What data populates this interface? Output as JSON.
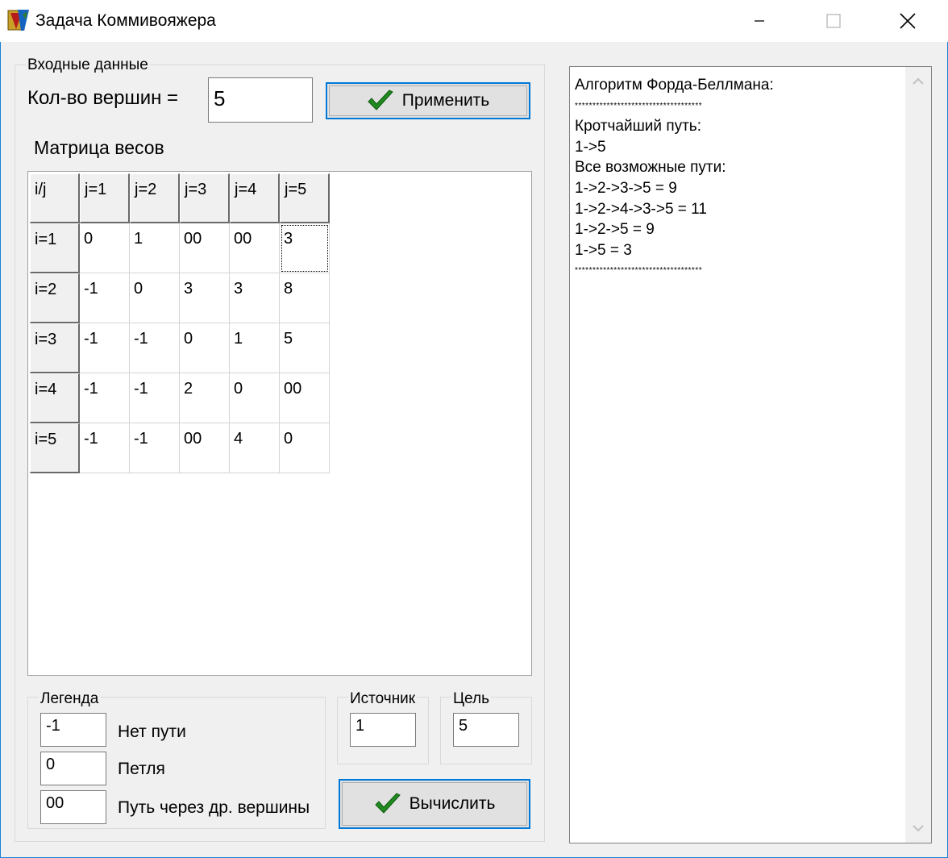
{
  "window": {
    "title": "Задача Коммивояжера"
  },
  "input_group": {
    "label": "Входные данные",
    "vertex_count_label": "Кол-во вершин =",
    "vertex_count_value": "5",
    "apply_button": "Применить",
    "matrix_label": "Матрица весов"
  },
  "matrix": {
    "corner": "i/j",
    "col_headers": [
      "j=1",
      "j=2",
      "j=3",
      "j=4",
      "j=5"
    ],
    "row_headers": [
      "i=1",
      "i=2",
      "i=3",
      "i=4",
      "i=5"
    ],
    "rows": [
      [
        "0",
        "1",
        "00",
        "00",
        "3"
      ],
      [
        "-1",
        "0",
        "3",
        "3",
        "8"
      ],
      [
        "-1",
        "-1",
        "0",
        "1",
        "5"
      ],
      [
        "-1",
        "-1",
        "2",
        "0",
        "00"
      ],
      [
        "-1",
        "-1",
        "00",
        "4",
        "0"
      ]
    ]
  },
  "legend": {
    "label": "Легенда",
    "items": [
      {
        "code": "-1",
        "text": "Нет пути"
      },
      {
        "code": "0",
        "text": "Петля"
      },
      {
        "code": "00",
        "text": "Путь через др. вершины"
      }
    ]
  },
  "source": {
    "label": "Источник",
    "value": "1"
  },
  "target": {
    "label": "Цель",
    "value": "5"
  },
  "compute_button": "Вычислить",
  "output": {
    "lines": [
      "Алгоритм Форда-Беллмана:",
      "************************************",
      "Кротчайший путь:",
      "1->5",
      "Все возможные пути:",
      "1->2->3->5 = 9",
      "1->2->4->3->5 = 11",
      "1->2->5 = 9",
      "1->5 = 3",
      "************************************"
    ]
  },
  "colors": {
    "accent": "#0078d7",
    "check_green": "#1f8a1f",
    "window_border": "#1883d7"
  }
}
